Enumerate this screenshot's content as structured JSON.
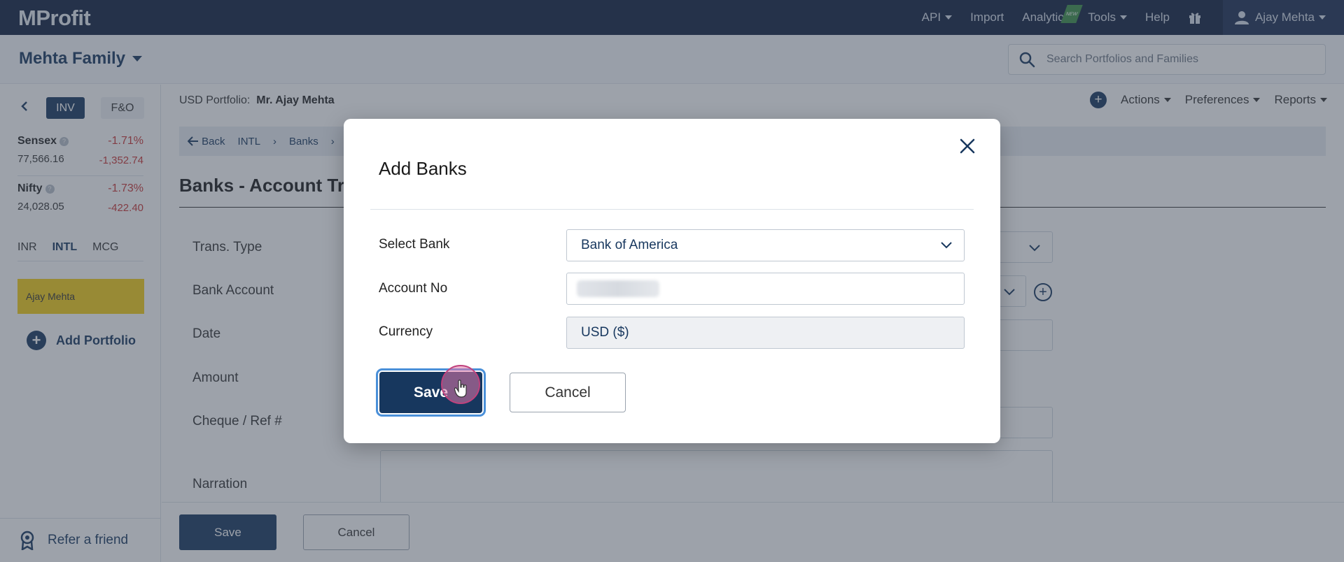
{
  "topnav": {
    "logo": "MProfit",
    "items": [
      {
        "label": "API",
        "has_caret": true
      },
      {
        "label": "Import",
        "has_caret": false
      },
      {
        "label": "Analytics",
        "has_caret": false,
        "badge": "NEW"
      },
      {
        "label": "Tools",
        "has_caret": true
      },
      {
        "label": "Help",
        "has_caret": false
      }
    ],
    "gift_icon": "gift-icon",
    "user_name": "Ajay Mehta"
  },
  "header": {
    "family_name": "Mehta Family",
    "search_placeholder": "Search Portfolios and Families"
  },
  "sidebar": {
    "toggle_inv": "INV",
    "toggle_fo": "F&O",
    "indices": [
      {
        "name": "Sensex",
        "pct": "-1.71%",
        "value": "77,566.16",
        "change": "-1,352.74"
      },
      {
        "name": "Nifty",
        "pct": "-1.73%",
        "value": "24,028.05",
        "change": "-422.40"
      }
    ],
    "help_glyph": "?",
    "currency_tabs": [
      "INR",
      "INTL",
      "MCG"
    ],
    "active_currency_tab": "INTL",
    "portfolio": "Ajay Mehta",
    "add_portfolio": "Add Portfolio",
    "refer": "Refer a friend"
  },
  "main": {
    "portfolio_prefix": "USD Portfolio:",
    "portfolio_name": "Mr. Ajay Mehta",
    "actions": [
      "Actions",
      "Preferences",
      "Reports"
    ],
    "breadcrumb": [
      "Back",
      "INTL",
      "Banks"
    ],
    "page_title": "Banks - Account Tr",
    "form_labels": [
      "Trans. Type",
      "Bank Account",
      "Date",
      "Amount",
      "Cheque / Ref #",
      "Narration"
    ],
    "save_label": "Save",
    "cancel_label": "Cancel"
  },
  "modal": {
    "title": "Add Banks",
    "fields": [
      {
        "label": "Select Bank",
        "value": "Bank of America",
        "type": "select"
      },
      {
        "label": "Account No",
        "value": "",
        "type": "text",
        "blurred": true
      },
      {
        "label": "Currency",
        "value": "USD ($)",
        "type": "readonly"
      }
    ],
    "save_label": "Save",
    "cancel_label": "Cancel"
  },
  "colors": {
    "navy": "#17375e",
    "topnav_bg": "#0f1f3f",
    "negative": "#c83434",
    "portfolio_highlight": "#f4ce14",
    "new_badge": "#3a8f46"
  }
}
